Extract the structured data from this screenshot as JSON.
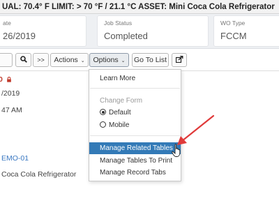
{
  "header": {
    "title": "UAL: 70.4° F LIMIT: > 70 °F / 21.1 °C ASSET: Mini Coca Cola Refrigerator"
  },
  "cards": [
    {
      "label": "ate",
      "value": "26/2019"
    },
    {
      "label": "Job Status",
      "value": "Completed"
    },
    {
      "label": "WO Type",
      "value": "FCCM"
    }
  ],
  "toolbar": {
    "search_icon": "search-icon",
    "next_label": ">>",
    "actions_label": "Actions",
    "options_label": "Options",
    "goto_label": "Go To List",
    "share_icon": "share-icon",
    "caret": "⌄"
  },
  "left_content": {
    "lines": [
      "0",
      "/2019",
      "47 AM",
      "",
      "EMO-01",
      "Coca Cola Refrigerator"
    ]
  },
  "options_menu": {
    "learn_more": "Learn More",
    "change_form_header": "Change Form",
    "default_label": "Default",
    "mobile_label": "Mobile",
    "selected_form": "Default",
    "manage_related": "Manage Related Tables",
    "manage_print": "Manage Tables To Print",
    "manage_record": "Manage Record Tabs",
    "highlighted_item": "Manage Related Tables"
  },
  "colors": {
    "highlight": "#337ab7",
    "link": "#3a78c2",
    "alert": "#c0392b",
    "annotation_arrow": "#e03a3a"
  }
}
